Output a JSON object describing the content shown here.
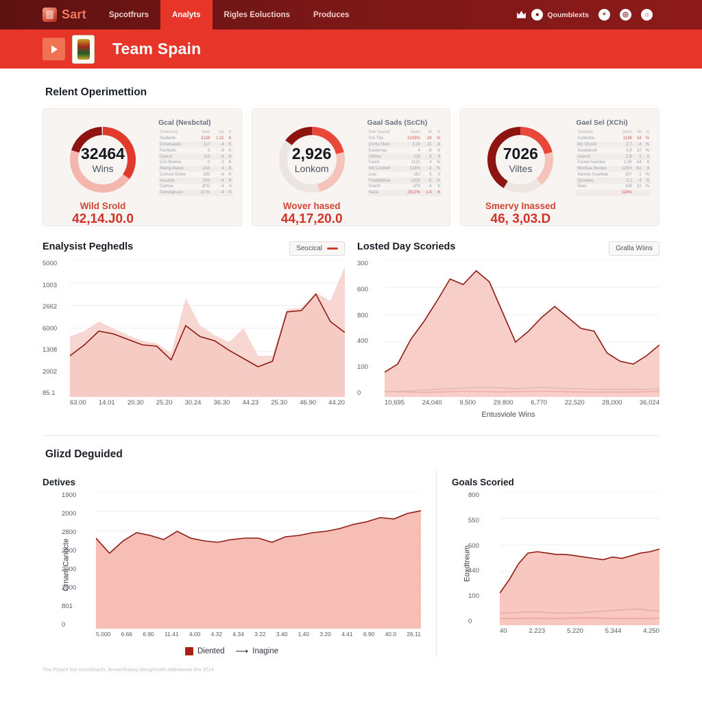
{
  "topnav": {
    "brand": "Sart",
    "links": [
      {
        "label": "Spcotfrurs",
        "active": false
      },
      {
        "label": "Analyts",
        "active": true
      },
      {
        "label": "Rigles Eoluctions",
        "active": false
      },
      {
        "label": "Produces",
        "active": false
      }
    ],
    "right_label": "Qoumblexts",
    "icons": [
      "crown-icon",
      "account-icon",
      "target-icon",
      "bell-icon"
    ]
  },
  "banner": {
    "title": "Team Spain",
    "play_icon": "play-icon",
    "crest_icon": "team-crest-icon"
  },
  "section": {
    "title": "Relent Operimettion"
  },
  "kpis": [
    {
      "value": "32464",
      "label": "Wins",
      "sub_label": "Wild Srold",
      "sub_value": "42,14.J0.0",
      "arc_pct": 62,
      "table_title": "Gcal (Nesbctal)",
      "columns": [
        "Cnnnciusl",
        "Aem",
        "Ga",
        "K"
      ],
      "rows": [
        [
          "Sedlants",
          "2128",
          "1.01",
          "K",
          true
        ],
        [
          "Cmebsaute",
          "117",
          "-4",
          "K",
          false
        ],
        [
          "Fonlisols",
          "3",
          "-6",
          "K",
          false
        ],
        [
          "Gpvrat",
          "119",
          "-6",
          "N",
          false
        ],
        [
          "Cen Borees",
          "0",
          "-2",
          "B",
          false
        ],
        [
          "Matng Matoo",
          "2A5",
          "4",
          "B",
          false
        ],
        [
          "Comsot Enine",
          "335",
          "-6",
          "K",
          false
        ],
        [
          "Aesants",
          "2X0",
          "-4",
          "R",
          false
        ],
        [
          "Cwlnse",
          "2FG",
          "-4",
          "4",
          false
        ],
        [
          "Gomstgnson",
          "22.%",
          "-4",
          "N",
          false
        ]
      ]
    },
    {
      "value": "2,926",
      "label": "Lonkom",
      "sub_label": "Wover hased",
      "sub_value": "44,17,20.0",
      "arc_pct": 46,
      "table_title": "Gaal Sads (ScCh)",
      "columns": [
        "Sne Sasnat",
        "Jeam",
        "M",
        "N"
      ],
      "rows": [
        [
          "Cnt Tdo",
          "2109%",
          "24",
          "%",
          true
        ],
        [
          "Cnnty Moel",
          "2,19",
          "21",
          "B",
          false
        ],
        [
          "Easlarnao",
          "4",
          "-6",
          "K",
          false
        ],
        [
          "Otfima",
          "119",
          "6",
          "6",
          false
        ],
        [
          "Fanot",
          "1131",
          "4",
          "%",
          false
        ],
        [
          "Wti Confeef",
          "116%",
          "-2",
          "%",
          false
        ],
        [
          "Lioo",
          "16J",
          "6",
          "h",
          false
        ],
        [
          "Foxpb6tdoe",
          "1205",
          "-5",
          "%",
          false
        ],
        [
          "Svemf",
          "1F9",
          "-4",
          "K",
          false
        ],
        [
          "Naza",
          "2512%",
          "1.4",
          "K",
          true
        ]
      ]
    },
    {
      "value": "7026",
      "label": "Viltes",
      "sub_label": "Smervy Inassed",
      "sub_value": "46, 3,03.D",
      "arc_pct": 74,
      "table_title": "Gael Sel (XChi)",
      "columns": [
        "Seasord",
        "Jams",
        "Mi",
        "N"
      ],
      "rows": [
        [
          "Cobtrnho",
          "1139",
          "18",
          "%",
          true
        ],
        [
          "Mo Gtsstd",
          "2.7",
          "-4",
          "%",
          false
        ],
        [
          "Soodlanoti",
          "3.9",
          "10",
          "%",
          false
        ],
        [
          "cisevot",
          "2.B",
          "2",
          "4",
          false
        ],
        [
          "Covee hueolea",
          "1.35",
          "64",
          "9",
          false
        ],
        [
          "Monfiaa Moclee",
          "125%",
          "Ko",
          "9",
          false
        ],
        [
          "Nanrbo Ceanlioe",
          "257",
          "1",
          "%",
          false
        ],
        [
          "Qcivbtoc",
          "5.J",
          "4",
          "R",
          false
        ],
        [
          "Haet",
          "109",
          "22",
          "%",
          false
        ],
        [
          "",
          "118%",
          "",
          "",
          true
        ]
      ]
    }
  ],
  "chart_data": [
    {
      "id": "analyst-pegheds",
      "type": "area",
      "title": "Enalysist Peghedls",
      "chip_label": "Seocical",
      "xlabel": "",
      "ylabel": "",
      "ytick_labels": [
        "5000",
        "1003",
        "2662",
        "6000",
        "1308",
        "2002",
        "85.1"
      ],
      "xtick_labels": [
        "63.00",
        "14.01",
        "20.30",
        "25.20",
        "30.24",
        "36.30",
        "44.23",
        "25.30",
        "46.90",
        "44.20"
      ],
      "ylim": [
        0,
        100
      ],
      "grid": true,
      "legend_position": "top-right",
      "series": [
        {
          "name": "Seocical",
          "color": "#8e1a12",
          "fill": "#f6c9c2",
          "values": [
            30,
            38,
            48,
            46,
            42,
            38,
            37,
            27,
            52,
            44,
            41,
            34,
            28,
            22,
            26,
            62,
            63,
            75,
            55,
            47
          ]
        },
        {
          "name": "band",
          "color": "none",
          "fill": "#f7cfc9",
          "values": [
            44,
            48,
            55,
            50,
            45,
            41,
            39,
            32,
            72,
            52,
            45,
            40,
            50,
            30,
            30,
            64,
            65,
            76,
            70,
            95
          ]
        }
      ]
    },
    {
      "id": "losted-day-scorieds",
      "type": "area",
      "title": "Losted Day Scorieds",
      "chip_label": "Gralla Wiins",
      "xlabel": "Entusviole Wins",
      "ylabel": "",
      "ytick_labels": [
        "300",
        "600",
        "800",
        "400",
        "100",
        "0"
      ],
      "xtick_labels": [
        "10,695",
        "24,040",
        "9,500",
        "29.800",
        "6,770",
        "22,520",
        "28,000",
        "36,024"
      ],
      "ylim": [
        0,
        100
      ],
      "grid": true,
      "legend_position": "top-right",
      "series": [
        {
          "name": "Gralla Wiins",
          "color": "#8e1a12",
          "fill": "#f7c6bf",
          "values": [
            18,
            24,
            42,
            55,
            70,
            86,
            82,
            92,
            84,
            62,
            40,
            48,
            58,
            66,
            58,
            50,
            48,
            32,
            26,
            24,
            30,
            38
          ]
        },
        {
          "name": "grey-baseline",
          "color": "#6b6b6b",
          "fill": "none",
          "values": [
            4,
            4,
            4.5,
            5,
            5.5,
            6,
            6.5,
            7,
            7,
            6.5,
            6,
            6.5,
            7,
            6.5,
            6,
            6,
            5.5,
            5.5,
            5.5,
            5.5,
            5.5,
            6
          ]
        },
        {
          "name": "red-baseline",
          "color": "#c62222",
          "fill": "none",
          "values": [
            4,
            3.8,
            3.6,
            3.4,
            3.6,
            3.8,
            4,
            4,
            3.8,
            3.6,
            3.8,
            4,
            4,
            4,
            3.8,
            3.6,
            3.6,
            3.6,
            3.6,
            3.6,
            3.8,
            4.2
          ]
        }
      ]
    },
    {
      "id": "detives",
      "type": "area",
      "title": "Detives",
      "group_title": "Glizd Deguided",
      "xlabel": "",
      "ylabel": "Crnam Canocte",
      "ytick_labels": [
        "1900",
        "2000",
        "2800",
        "2000",
        "2000",
        "2000",
        "801",
        "0"
      ],
      "xtick_labels": [
        "5.000",
        "6.66",
        "6.90",
        "11.41",
        "4.00",
        "4.32",
        "4.34",
        "3.22",
        "3.40",
        "1.40",
        "3.20",
        "4.41",
        "6.90",
        "40.0",
        "26.11"
      ],
      "ylim": [
        0,
        100
      ],
      "grid": true,
      "legend_position": "bottom-center",
      "legend_items": [
        {
          "label": "Diented",
          "marker": "square",
          "color": "#a81f14"
        },
        {
          "label": "Inagine",
          "marker": "arrow",
          "color": "#1b1f26"
        }
      ],
      "series": [
        {
          "name": "Diented",
          "color": "#8e1a12",
          "fill": "#f6b3a9",
          "values": [
            66,
            55,
            64,
            70,
            68,
            65,
            71,
            66,
            64,
            63,
            65,
            66,
            66,
            63,
            67,
            68,
            70,
            71,
            73,
            76,
            78,
            81,
            80,
            84,
            86
          ]
        }
      ]
    },
    {
      "id": "goals-scoried",
      "type": "area",
      "title": "Goals Scoried",
      "xlabel": "",
      "ylabel": "Eoxdtreum",
      "ytick_labels": [
        "800",
        "550",
        "600",
        "440",
        "100",
        "0"
      ],
      "xtick_labels": [
        "40",
        "2.223",
        "5.220",
        "5.344",
        "4.250"
      ],
      "ylim": [
        0,
        100
      ],
      "grid": true,
      "legend_position": "none",
      "series": [
        {
          "name": "Eoxdtreum",
          "color": "#8e1a12",
          "fill": "#f7bdb4",
          "values": [
            24,
            34,
            46,
            54,
            55,
            54,
            53,
            53,
            52,
            51,
            50,
            49,
            51,
            50,
            52,
            54,
            55,
            57
          ]
        },
        {
          "name": "grey-baseline",
          "color": "#5a5a5a",
          "fill": "none",
          "values": [
            9,
            9,
            9.5,
            10,
            10,
            9.5,
            9,
            9,
            9,
            9.5,
            10,
            10.5,
            11,
            11.5,
            12,
            12,
            11,
            10.5
          ]
        },
        {
          "name": "red-baseline",
          "color": "#c0201a",
          "fill": "none",
          "values": [
            5,
            5,
            5,
            5.2,
            5.2,
            5,
            5,
            5,
            5.4,
            5.5,
            5.4,
            5.2,
            5,
            5,
            5,
            5,
            5,
            5.2
          ]
        }
      ]
    }
  ],
  "bottom": {
    "group_title": "Glizd Deguided"
  },
  "footer": {
    "note": "Tha Prpant Sol Inunctmanh, lenuer/Eskog dlaug/nvath ofidniarove tha 2014"
  }
}
